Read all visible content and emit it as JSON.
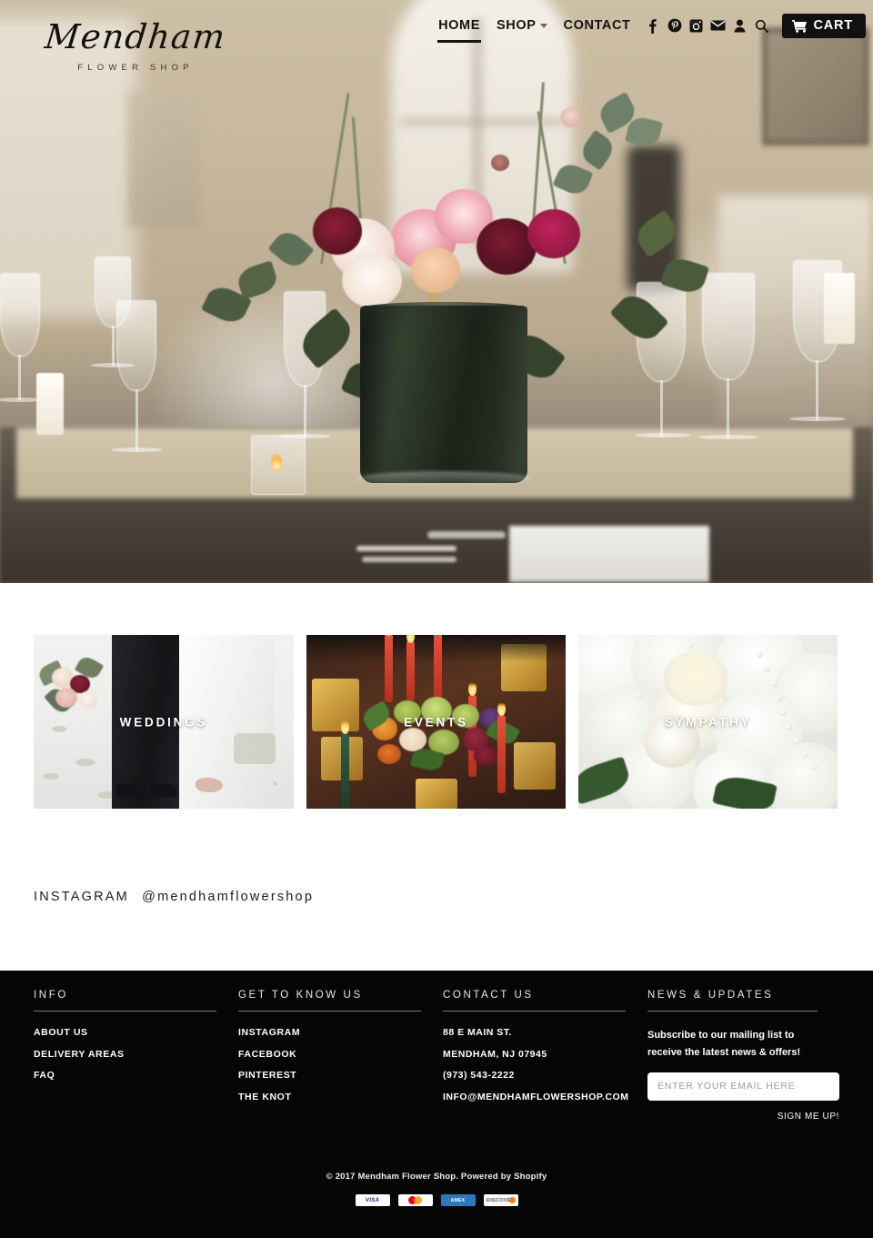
{
  "site": {
    "logo_name": "Mendham",
    "logo_tagline": "FLOWER SHOP"
  },
  "nav": {
    "items": [
      {
        "label": "HOME",
        "active": true
      },
      {
        "label": "SHOP",
        "has_dropdown": true
      },
      {
        "label": "CONTACT"
      }
    ],
    "social_icons": [
      "facebook-icon",
      "pinterest-icon",
      "instagram-icon",
      "email-icon",
      "account-icon",
      "search-icon"
    ],
    "cart_label": "CART"
  },
  "hero": {
    "alt": "Floral centerpiece of pink and burgundy roses with eucalyptus in a dark vase on a set dining table"
  },
  "categories": [
    {
      "label": "WEDDINGS"
    },
    {
      "label": "EVENTS"
    },
    {
      "label": "SYMPATHY"
    }
  ],
  "instagram": {
    "label": "INSTAGRAM",
    "handle": "@mendhamflowershop"
  },
  "footer": {
    "columns": [
      {
        "title": "INFO",
        "links": [
          "ABOUT US",
          "DELIVERY AREAS",
          "FAQ"
        ]
      },
      {
        "title": "GET TO KNOW US",
        "links": [
          "INSTAGRAM",
          "FACEBOOK",
          "PINTEREST",
          "THE KNOT"
        ]
      }
    ],
    "contact": {
      "title": "CONTACT US",
      "address_line1": "88 E MAIN ST.",
      "address_line2": "MENDHAM, NJ 07945",
      "phone": "(973) 543-2222",
      "email": "INFO@MENDHAMFLOWERSHOP.COM"
    },
    "newsletter": {
      "title": "NEWS & UPDATES",
      "description": "Subscribe to our mailing list to receive the latest news & offers!",
      "placeholder": "ENTER YOUR EMAIL HERE",
      "value": "",
      "button_label": "SIGN ME UP!"
    },
    "copyright": "© 2017 Mendham Flower Shop. Powered by Shopify",
    "payment_methods": [
      "VISA",
      "MASTERCARD",
      "AMERICAN EXPRESS",
      "DISCOVER"
    ],
    "payment_labels": {
      "visa": "VISA",
      "amex": "AMERICAN EXPRESS",
      "discover": "DISCOVER"
    }
  },
  "colors": {
    "footer_bg": "#050505",
    "cart_bg": "#111111",
    "text_dark": "#16130f",
    "card_label": "#ffffff"
  }
}
